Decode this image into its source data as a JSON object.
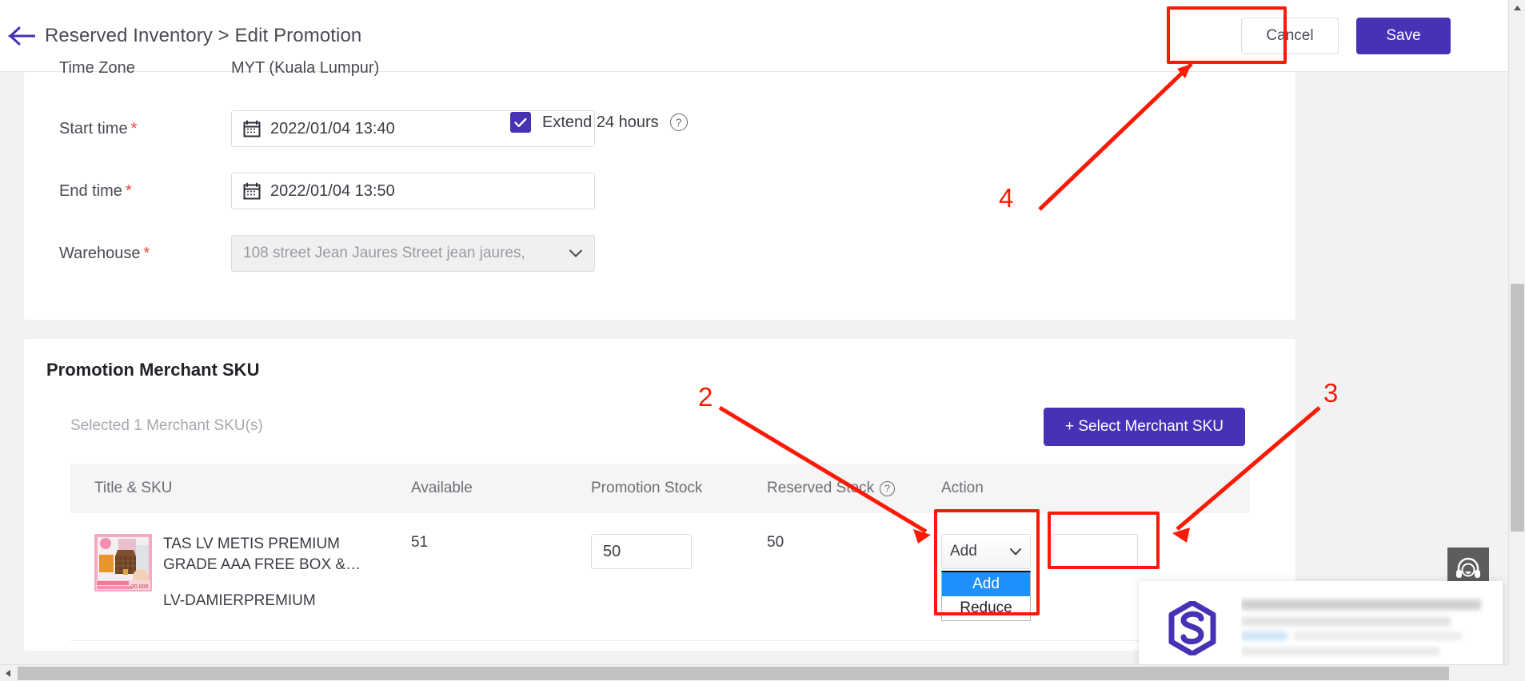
{
  "header": {
    "back_icon": "arrow-left-icon",
    "breadcrumb": "Reserved Inventory > Edit Promotion",
    "cancel_label": "Cancel",
    "save_label": "Save"
  },
  "schedule": {
    "timezone_label": "Time Zone",
    "timezone_value": "MYT (Kuala Lumpur)",
    "start_label": "Start time",
    "start_value": "2022/01/04 13:40",
    "end_label": "End time",
    "end_value": "2022/01/04 13:50",
    "warehouse_label": "Warehouse",
    "warehouse_value": "108 street Jean Jaures Street jean jaures,",
    "required_mark": "*",
    "extend_label": "Extend 24 hours",
    "help_glyph": "?"
  },
  "sku_section": {
    "title": "Promotion Merchant SKU",
    "selected_count": "Selected 1 Merchant SKU(s)",
    "select_button": "+ Select Merchant SKU",
    "columns": [
      "Title & SKU",
      "Available",
      "Promotion Stock",
      "Reserved Stock",
      "Action"
    ],
    "reserved_help_glyph": "?",
    "rows": [
      {
        "title": "TAS LV METIS PREMIUM GRADE AAA FREE BOX &…",
        "sku": "LV-DAMIERPREMIUM",
        "available": "51",
        "promotion_stock": "50",
        "reserved_stock": "50",
        "action_selected": "Add",
        "action_options": [
          "Add",
          "Reduce"
        ],
        "action_qty": "",
        "thumbnail": "product-bag-thumbnail"
      }
    ]
  },
  "annotations": {
    "numbers": [
      "2",
      "3",
      "4"
    ]
  },
  "widgets": {
    "support_icon": "headset-icon",
    "chat_logo": "hexagon-s-logo"
  },
  "colors": {
    "primary": "#4632b4",
    "annotation": "#fc1a06",
    "required": "#e8453c",
    "dropdown_highlight": "#1e90ff"
  }
}
